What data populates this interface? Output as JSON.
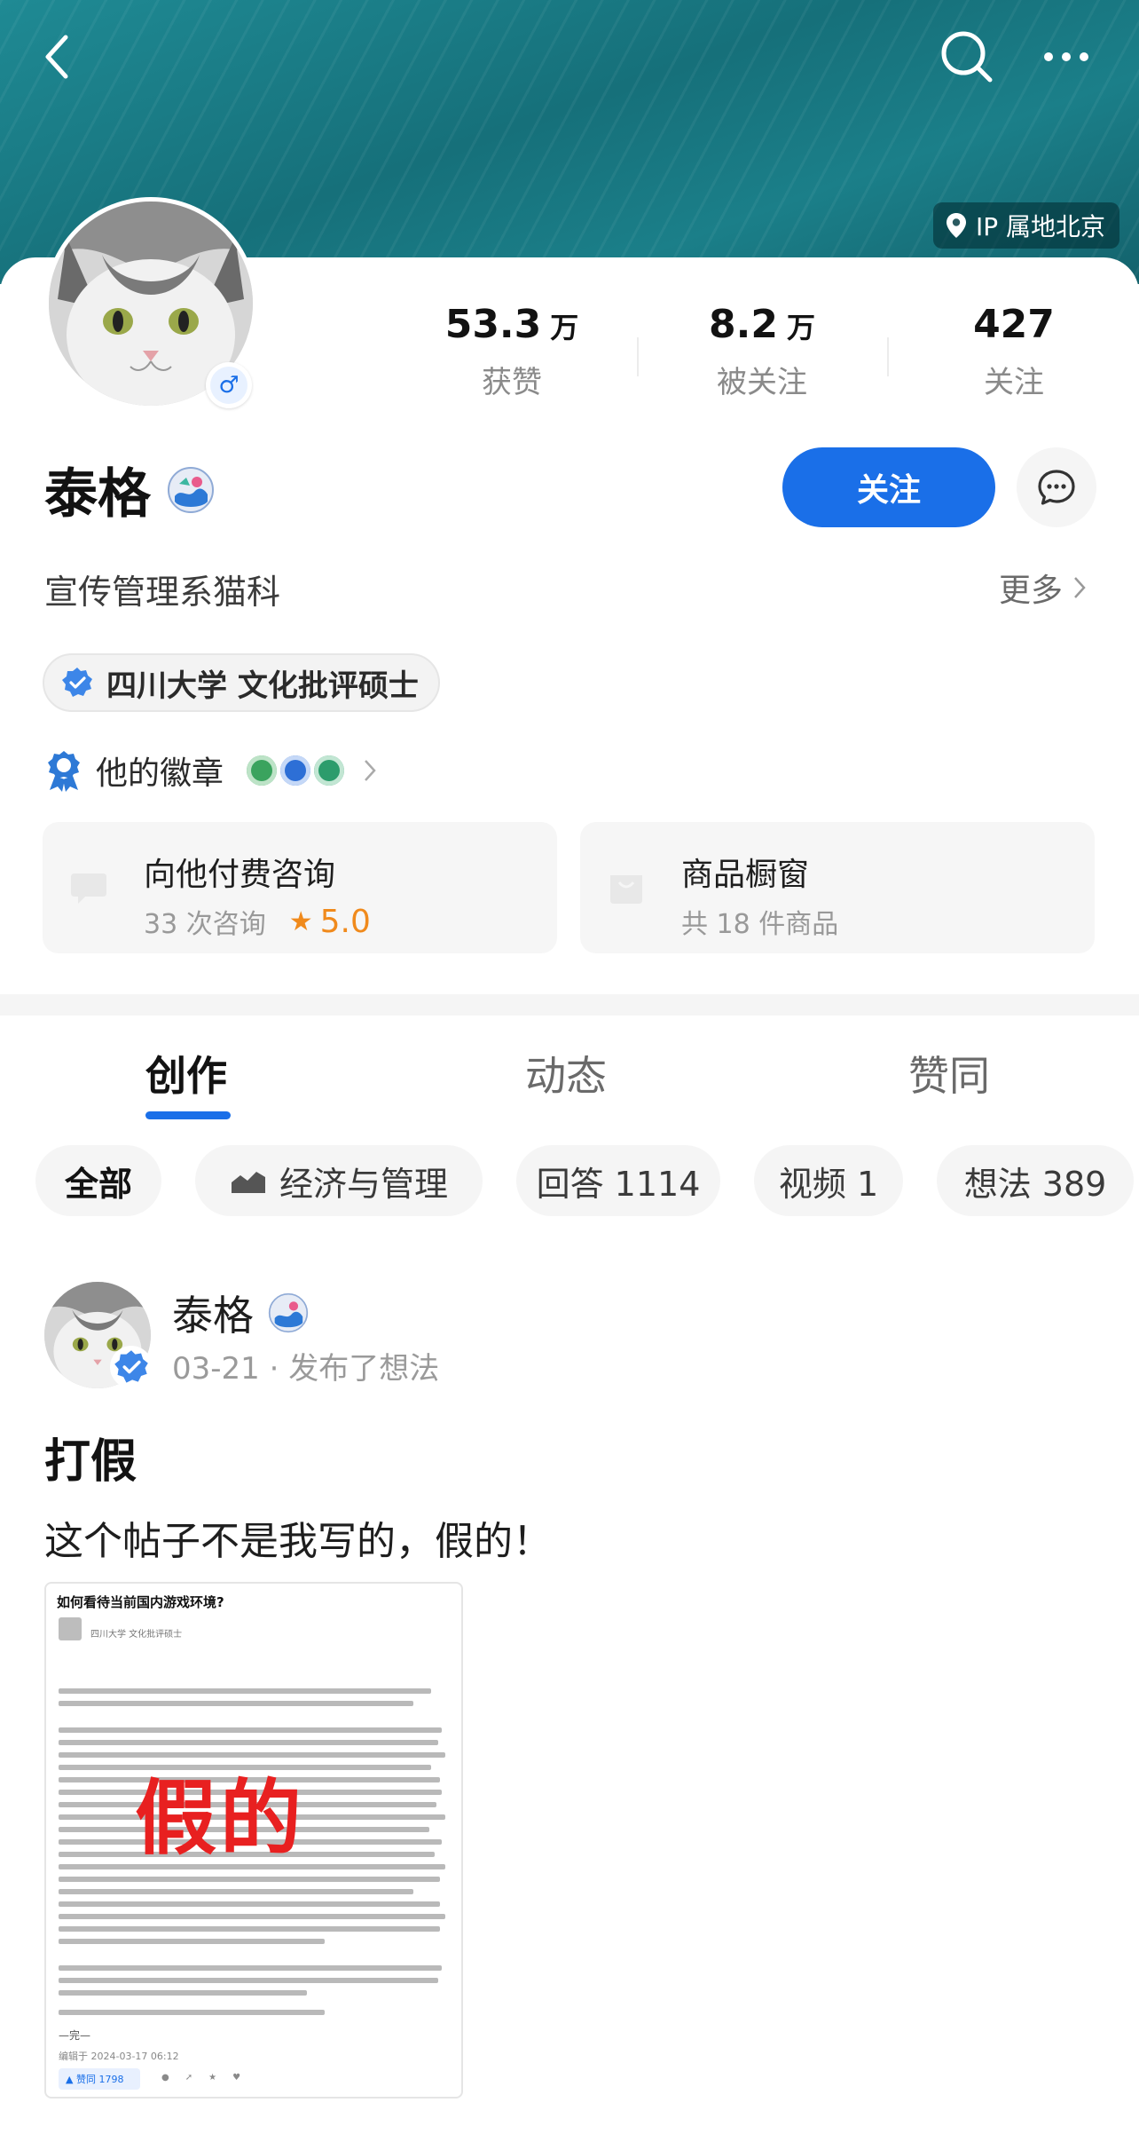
{
  "header": {
    "ip_location": "IP 属地北京"
  },
  "profile": {
    "name": "泰格",
    "bio": "宣传管理系猫科",
    "more_label": "更多",
    "follow_label": "关注",
    "education": "四川大学 文化批评硕士",
    "badges_label": "他的徽章"
  },
  "stats": [
    {
      "num": "53.3",
      "unit": "万",
      "label": "获赞"
    },
    {
      "num": "8.2",
      "unit": "万",
      "label": "被关注"
    },
    {
      "num": "427",
      "unit": "",
      "label": "关注"
    }
  ],
  "services": [
    {
      "title": "向他付费咨询",
      "sub": "33 次咨询",
      "rating": "5.0"
    },
    {
      "title": "商品橱窗",
      "sub": "共 18 件商品"
    }
  ],
  "tabs": [
    "创作",
    "动态",
    "赞同"
  ],
  "chips": [
    "全部",
    "经济与管理",
    "回答 1114",
    "视频 1",
    "想法 389"
  ],
  "post": {
    "author": "泰格",
    "meta": "03-21 · 发布了想法",
    "title": "打假",
    "text": "这个帖子不是我写的，假的！",
    "image": {
      "title": "如何看待当前国内游戏环境?",
      "school": "四川大学 文化批评硕士",
      "stamp": "假的",
      "closing": "—完—",
      "date": "编辑于 2024-03-17 06:12",
      "vote": "▲ 赞同 1798"
    }
  },
  "colors": {
    "accent": "#1a6fe8",
    "banner": "#1b7f89",
    "rating": "#f08a1c",
    "stamp": "#e82020"
  }
}
